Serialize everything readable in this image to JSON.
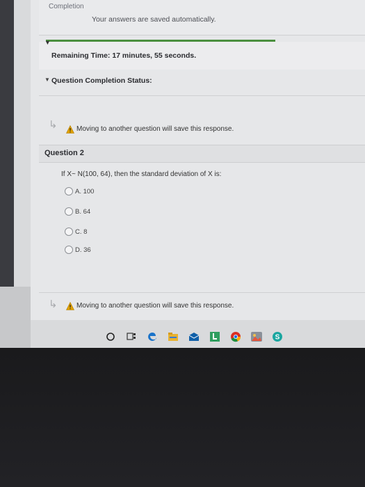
{
  "header": {
    "completion_label": "Completion",
    "autosave_text": "Your answers are saved automatically.",
    "progress_fraction": 1.0,
    "progress_color": "#4b8f3f"
  },
  "timer": {
    "text": "Remaining Time: 17 minutes, 55 seconds."
  },
  "status": {
    "label": "Question Completion Status:"
  },
  "warnings": {
    "top": "Moving to another question will save this response.",
    "bottom": "Moving to another question will save this response."
  },
  "question": {
    "title": "Question 2",
    "text": "If X~ N(100, 64), then the standard deviation of X is:",
    "options": [
      {
        "label": "A. 100"
      },
      {
        "label": "B. 64"
      },
      {
        "label": "C. 8"
      },
      {
        "label": "D. 36"
      }
    ]
  },
  "taskbar": {
    "icons": [
      "cortana-circle-icon",
      "task-view-icon",
      "edge-icon",
      "file-explorer-icon",
      "mail-icon",
      "store-icon",
      "chrome-icon",
      "photos-icon",
      "skype-icon"
    ]
  },
  "colors": {
    "warning": "#e0a100",
    "accent": "#2b6cb0"
  }
}
